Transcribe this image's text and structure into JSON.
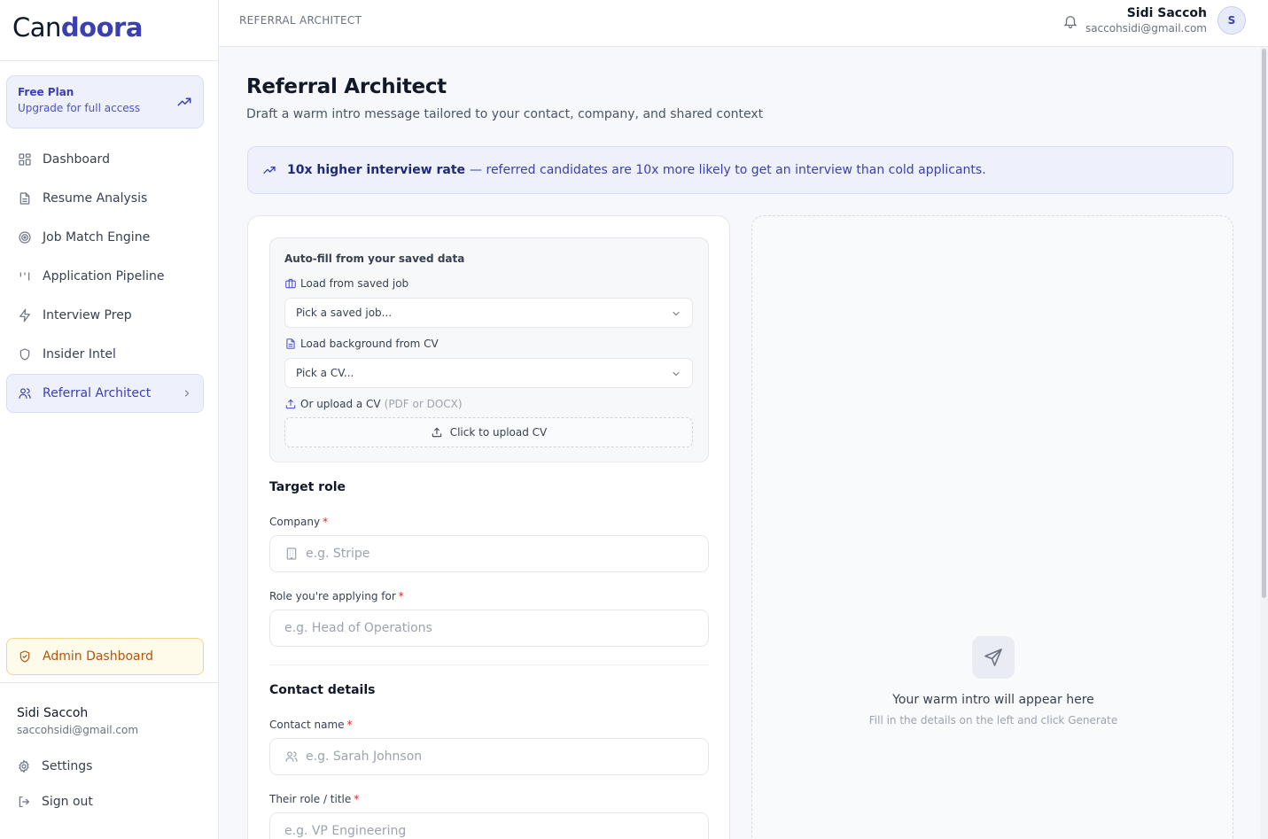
{
  "brand": {
    "logo_light": "Can",
    "logo_bold": "doora"
  },
  "plan": {
    "title": "Free Plan",
    "subtitle": "Upgrade for full access"
  },
  "nav": {
    "items": [
      {
        "label": "Dashboard",
        "icon": "grid-icon"
      },
      {
        "label": "Resume Analysis",
        "icon": "document-icon"
      },
      {
        "label": "Job Match Engine",
        "icon": "target-icon"
      },
      {
        "label": "Application Pipeline",
        "icon": "columns-icon"
      },
      {
        "label": "Interview Prep",
        "icon": "lightning-icon"
      },
      {
        "label": "Insider Intel",
        "icon": "shield-icon"
      },
      {
        "label": "Referral Architect",
        "icon": "users-icon",
        "active": true
      }
    ]
  },
  "admin": {
    "label": "Admin Dashboard"
  },
  "sidebar_user": {
    "name": "Sidi Saccoh",
    "email": "saccohsidi@gmail.com"
  },
  "sidebar_links": {
    "settings": "Settings",
    "signout": "Sign out"
  },
  "header": {
    "breadcrumb": "REFERRAL ARCHITECT",
    "user_name": "Sidi Saccoh",
    "user_email": "saccohsidi@gmail.com",
    "avatar_initial": "S"
  },
  "page": {
    "title": "Referral Architect",
    "subtitle": "Draft a warm intro message tailored to your contact, company, and shared context"
  },
  "banner": {
    "bold": "10x higher interview rate",
    "text": "— referred candidates are 10x more likely to get an interview than cold applicants."
  },
  "autofill": {
    "title": "Auto-fill from your saved data",
    "job_label": "Load from saved job",
    "job_select": "Pick a saved job...",
    "cv_label": "Load background from CV",
    "cv_select": "Pick a CV...",
    "upload_label": "Or upload a CV",
    "upload_hint": "(PDF or DOCX)",
    "upload_button": "Click to upload CV"
  },
  "form": {
    "target_role_title": "Target role",
    "company_label": "Company",
    "company_placeholder": "e.g. Stripe",
    "role_label": "Role you're applying for",
    "role_placeholder": "e.g. Head of Operations",
    "contact_title": "Contact details",
    "contact_name_label": "Contact name",
    "contact_name_placeholder": "e.g. Sarah Johnson",
    "their_role_label": "Their role / title",
    "their_role_placeholder": "e.g. VP Engineering",
    "required_mark": "*"
  },
  "output": {
    "title": "Your warm intro will appear here",
    "subtitle": "Fill in the details on the left and click Generate"
  },
  "colors": {
    "accent": "#3b3fb0",
    "admin": "#b45309",
    "required": "#dc2626"
  }
}
